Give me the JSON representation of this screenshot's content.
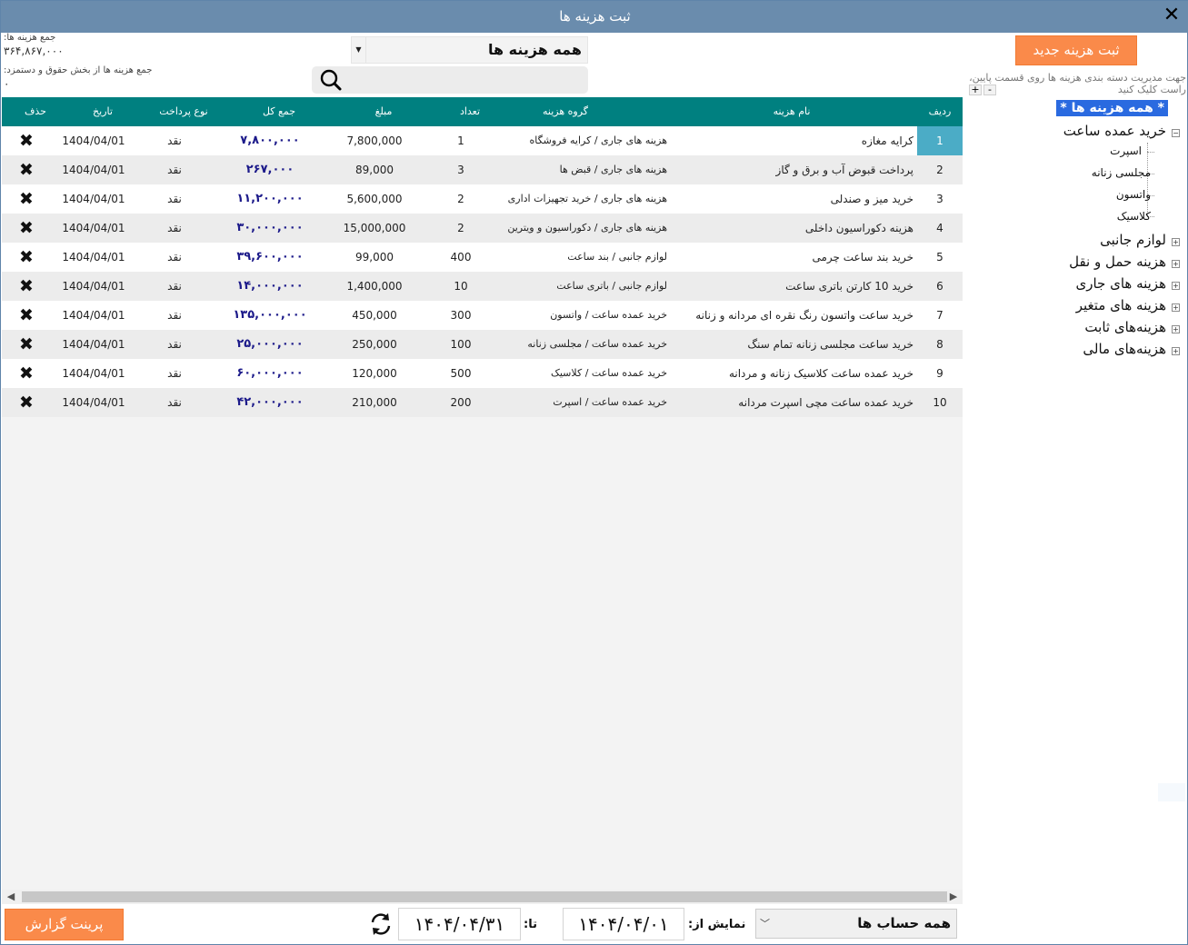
{
  "window": {
    "title": "ثبت هزینه ها",
    "close_icon": "close-icon"
  },
  "totals": {
    "expenses_label": "جمع هزینه ها:",
    "expenses_value": "۳۶۴,۸۶۷,۰۰۰",
    "salary_label": "جمع هزینه ها از بخش حقوق و دستمزد:",
    "salary_value": "۰"
  },
  "filter": {
    "selected": "همه هزینه ها"
  },
  "search": {
    "placeholder": "",
    "value": ""
  },
  "table": {
    "headers": {
      "idx": "ردیف",
      "name": "نام هزینه",
      "group": "گروه هزینه",
      "count": "تعداد",
      "amount": "مبلغ",
      "total": "جمع کل",
      "payment": "نوع پرداخت",
      "date": "تاریخ",
      "delete": "حذف"
    },
    "rows": [
      {
        "idx": "1",
        "name": "کرایه مغازه",
        "group": "هزینه های جاری / کرایه فروشگاه",
        "count": "1",
        "amount": "7,800,000",
        "total": "۷,۸۰۰,۰۰۰",
        "payment": "نقد",
        "date": "1404/04/01"
      },
      {
        "idx": "2",
        "name": "پرداخت قبوض آب و برق و گاز",
        "group": "هزینه های جاری / قبض ها",
        "count": "3",
        "amount": "89,000",
        "total": "۲۶۷,۰۰۰",
        "payment": "نقد",
        "date": "1404/04/01"
      },
      {
        "idx": "3",
        "name": "خرید میز و صندلی",
        "group": "هزینه های جاری / خرید تجهیزات اداری",
        "count": "2",
        "amount": "5,600,000",
        "total": "۱۱,۲۰۰,۰۰۰",
        "payment": "نقد",
        "date": "1404/04/01"
      },
      {
        "idx": "4",
        "name": "هزینه دکوراسیون داخلی",
        "group": "هزینه های جاری / دکوراسیون و ویترین",
        "count": "2",
        "amount": "15,000,000",
        "total": "۳۰,۰۰۰,۰۰۰",
        "payment": "نقد",
        "date": "1404/04/01"
      },
      {
        "idx": "5",
        "name": "خرید بند ساعت چرمی",
        "group": "لوازم جانبی / بند ساعت",
        "count": "400",
        "amount": "99,000",
        "total": "۳۹,۶۰۰,۰۰۰",
        "payment": "نقد",
        "date": "1404/04/01"
      },
      {
        "idx": "6",
        "name": "خرید 10 کارتن باتری ساعت",
        "group": "لوازم جانبی / باتری ساعت",
        "count": "10",
        "amount": "1,400,000",
        "total": "۱۴,۰۰۰,۰۰۰",
        "payment": "نقد",
        "date": "1404/04/01"
      },
      {
        "idx": "7",
        "name": "خرید ساعت واتسون رنگ نقره ای مردانه و زنانه",
        "group": "خرید عمده ساعت / واتسون",
        "count": "300",
        "amount": "450,000",
        "total": "۱۳۵,۰۰۰,۰۰۰",
        "payment": "نقد",
        "date": "1404/04/01"
      },
      {
        "idx": "8",
        "name": "خرید ساعت مجلسی زنانه تمام سنگ",
        "group": "خرید عمده ساعت / مجلسی زنانه",
        "count": "100",
        "amount": "250,000",
        "total": "۲۵,۰۰۰,۰۰۰",
        "payment": "نقد",
        "date": "1404/04/01"
      },
      {
        "idx": "9",
        "name": "خرید عمده ساعت کلاسیک زنانه و مردانه",
        "group": "خرید عمده ساعت / کلاسیک",
        "count": "500",
        "amount": "120,000",
        "total": "۶۰,۰۰۰,۰۰۰",
        "payment": "نقد",
        "date": "1404/04/01"
      },
      {
        "idx": "10",
        "name": "خرید عمده ساعت مچی اسپرت مردانه",
        "group": "خرید عمده ساعت / اسپرت",
        "count": "200",
        "amount": "210,000",
        "total": "۴۲,۰۰۰,۰۰۰",
        "payment": "نقد",
        "date": "1404/04/01"
      }
    ]
  },
  "sidebar": {
    "new_button": "ثبت هزینه جدید",
    "hint": "جهت مدیریت دسته بندی هزینه ها روی قسمت پایین، راست کلیک کنید",
    "plus": "+",
    "minus": "-",
    "tree": {
      "root": "* همه هزینه ها *",
      "expanded": "خرید عمده ساعت",
      "children": [
        "اسپرت",
        "مجلسی زنانه",
        "واتسون",
        "کلاسیک"
      ],
      "collapsed": [
        "لوازم جانبی",
        "هزینه حمل و نقل",
        "هزینه های جاری",
        "هزینه های متغیر",
        "هزینه‌های ثابت",
        "هزینه‌های مالی"
      ]
    }
  },
  "bottom": {
    "print_button": "پرینت گزارش",
    "to_label": "تا:",
    "to_date": "۱۴۰۴/۰۴/۳۱",
    "from_label": "نمایش از:",
    "from_date": "۱۴۰۴/۰۴/۰۱",
    "account_selected": "همه حساب ها"
  }
}
